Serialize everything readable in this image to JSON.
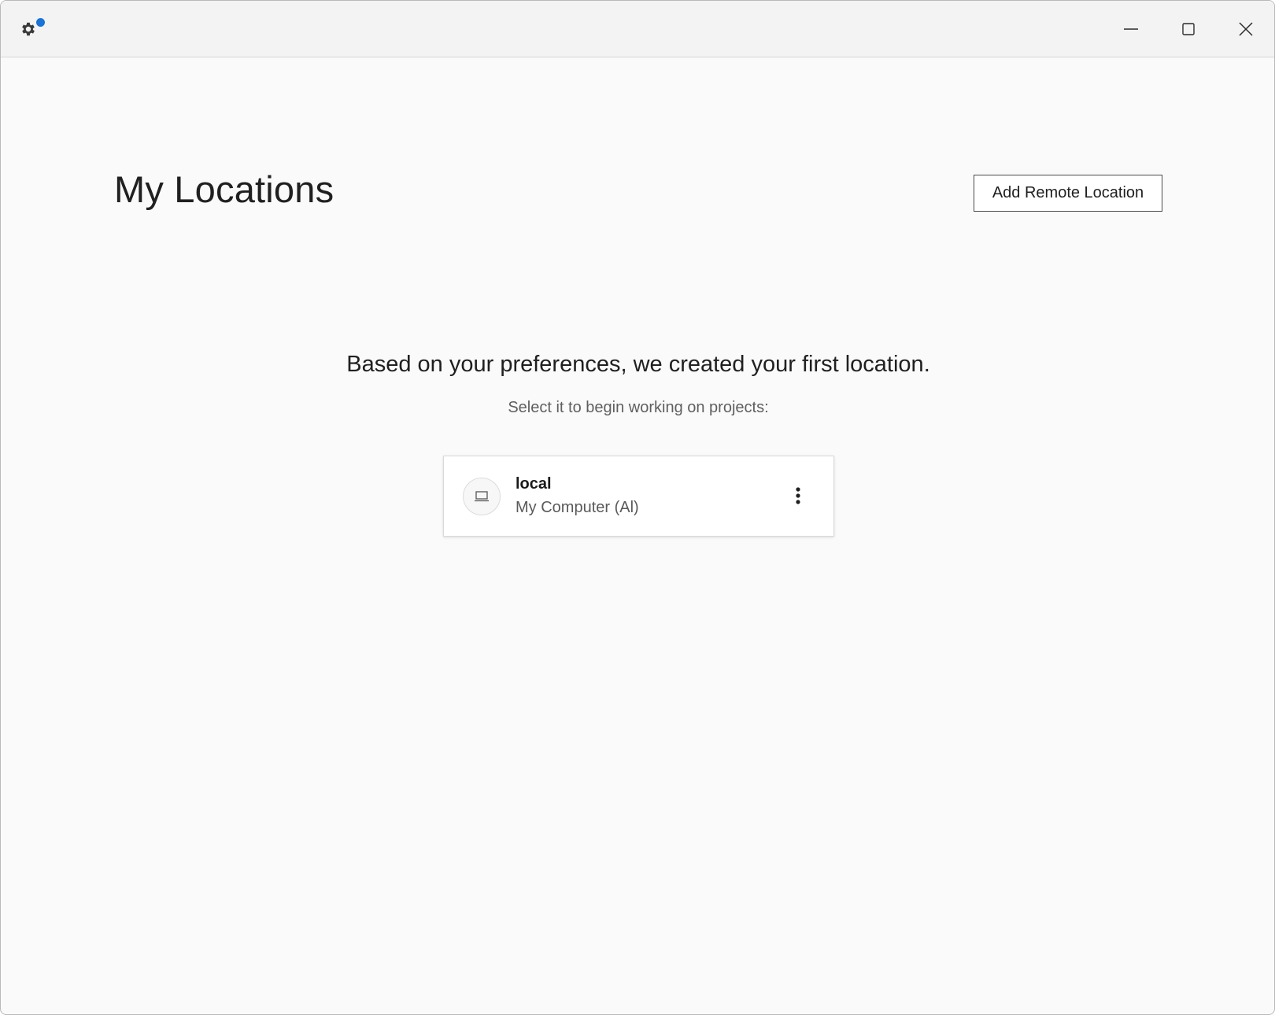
{
  "titlebar": {
    "settings_icon": "gear-icon",
    "notification_color": "#1a73d6",
    "controls": [
      "minimize-icon",
      "maximize-icon",
      "close-icon"
    ]
  },
  "main": {
    "title": "My Locations",
    "add_remote_label": "Add Remote Location",
    "headline": "Based on your preferences, we created your first location.",
    "subline": "Select it to begin working on projects:"
  },
  "locations": [
    {
      "name": "local",
      "description": "My Computer (Al)",
      "icon": "laptop-icon",
      "menu_icon": "more-vertical-icon"
    }
  ],
  "colors": {
    "accent": "#1a73d6",
    "background": "#fafafa",
    "titlebar": "#f3f3f3"
  }
}
